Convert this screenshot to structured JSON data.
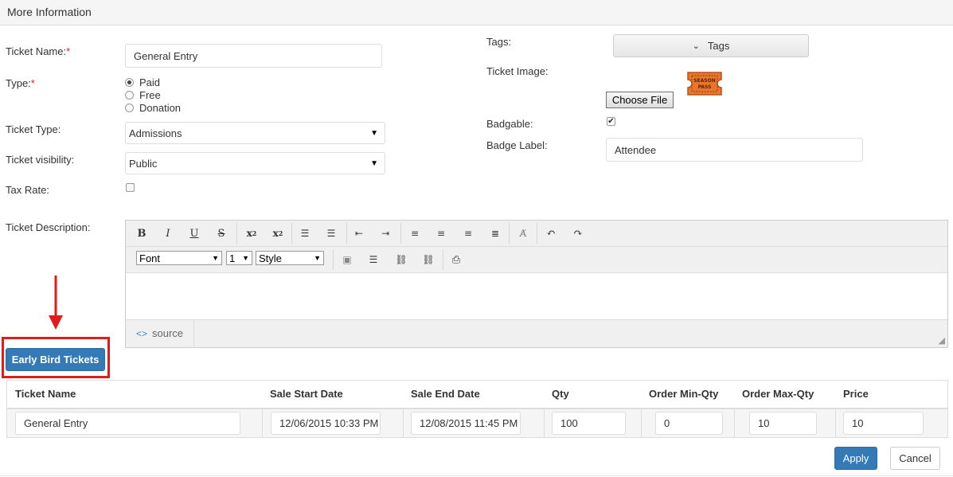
{
  "panel": {
    "title": "More Information"
  },
  "form": {
    "ticket_name_label": "Ticket Name:",
    "required_mark": "*",
    "ticket_name_value": "General Entry",
    "type_label": "Type:",
    "type_options": [
      "Paid",
      "Free",
      "Donation"
    ],
    "type_selected": "Paid",
    "ticket_type_label": "Ticket Type:",
    "ticket_type_value": "Admissions",
    "visibility_label": "Ticket visibility:",
    "visibility_value": "Public",
    "tax_rate_label": "Tax Rate:",
    "tax_rate_checked": false,
    "tags_label": "Tags:",
    "tags_button": "Tags",
    "image_label": "Ticket Image:",
    "image_badge_line1": "SEASON",
    "image_badge_line2": "PASS",
    "choose_file": "Choose File",
    "badgable_label": "Badgable:",
    "badgable_checked": true,
    "badge_label_label": "Badge Label:",
    "badge_label_value": "Attendee",
    "description_label": "Ticket Description:"
  },
  "editor": {
    "font_select": "Font",
    "size_select": "1",
    "style_select": "Style",
    "source_label": "source"
  },
  "early_bird": {
    "label": "Early Bird Tickets"
  },
  "table": {
    "headers": [
      "Ticket Name",
      "Sale Start Date",
      "Sale End Date",
      "Qty",
      "Order Min-Qty",
      "Order Max-Qty",
      "Price"
    ],
    "row": [
      "General Entry",
      "12/06/2015 10:33 PM",
      "12/08/2015 11:45 PM",
      "100",
      "0",
      "10",
      "10"
    ]
  },
  "actions": {
    "apply": "Apply",
    "cancel": "Cancel"
  },
  "colors": {
    "primary": "#337ab7",
    "highlight": "#e01d1d",
    "required": "#d9231f",
    "ticket_orange": "#e8762d"
  }
}
